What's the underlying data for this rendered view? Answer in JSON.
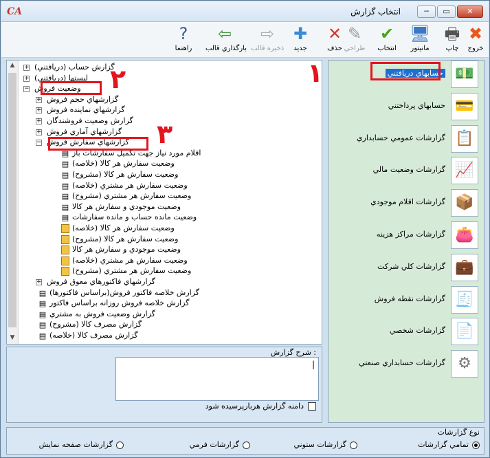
{
  "window": {
    "logo": "CA",
    "title": "انتخاب گزارش",
    "min_glyph": "─",
    "max_glyph": "▭",
    "close_glyph": "✕"
  },
  "toolbar": [
    {
      "label": "خروج",
      "icon": "close-icon",
      "glyph": "✖",
      "color": "#e8571b",
      "enabled": true
    },
    {
      "label": "چاپ",
      "icon": "printer-icon",
      "glyph": "🖶",
      "color": "#555555",
      "enabled": true
    },
    {
      "label": "مانيتور",
      "icon": "monitor-icon",
      "glyph": "🖥",
      "color": "#3b78c4",
      "enabled": true
    },
    {
      "label": "انتخاب",
      "icon": "check-icon",
      "glyph": "✔",
      "color": "#4aa31c",
      "enabled": true
    },
    {
      "label": "طراحي",
      "icon": "design-icon",
      "glyph": "✎",
      "color": "#9a9a9a",
      "enabled": false
    },
    {
      "label": "حذف",
      "icon": "delete-doc-icon",
      "glyph": "✕",
      "color": "#d23a2a",
      "enabled": true
    },
    {
      "label": "جديد",
      "icon": "new-doc-icon",
      "glyph": "✚",
      "color": "#3a8ad6",
      "enabled": true
    },
    {
      "label": "ذخيره قالب",
      "icon": "save-template-icon",
      "glyph": "⇨",
      "color": "#b0b0b0",
      "enabled": false
    },
    {
      "label": "بارگذاري قالب",
      "icon": "load-template-icon",
      "glyph": "⇦",
      "color": "#3aa038",
      "enabled": true
    },
    {
      "label": "راهنما",
      "icon": "help-icon",
      "glyph": "?",
      "color": "#3a5a8a",
      "enabled": true
    }
  ],
  "tree": [
    {
      "label": "گزارش حساب (دريافتني)",
      "level": 0,
      "expander": "+",
      "leaf": ""
    },
    {
      "label": "ليستها (دريافتني)",
      "level": 0,
      "expander": "+",
      "leaf": ""
    },
    {
      "label": "وضعيت فروش",
      "level": 0,
      "expander": "−",
      "leaf": ""
    },
    {
      "label": "گزارشهاي حجم فروش",
      "level": 1,
      "expander": "+",
      "leaf": ""
    },
    {
      "label": "گزارشهاي نماينده فروش",
      "level": 1,
      "expander": "+",
      "leaf": ""
    },
    {
      "label": "گزارش وضعيت فروشندگان",
      "level": 1,
      "expander": "+",
      "leaf": ""
    },
    {
      "label": "گزارشهاي آماري فروش",
      "level": 1,
      "expander": "+",
      "leaf": ""
    },
    {
      "label": "گزارشهاي سفارش فروش",
      "level": 1,
      "expander": "−",
      "leaf": ""
    },
    {
      "label": "اقلام مورد نياز جهت تكميل سفارشات باز",
      "level": 2,
      "expander": "",
      "leaf": "doc"
    },
    {
      "label": "وضعيت سفارش هر كالا (خلاصه)",
      "level": 2,
      "expander": "",
      "leaf": "doc"
    },
    {
      "label": "وضعيت سفارش هر كالا (مشروح)",
      "level": 2,
      "expander": "",
      "leaf": "doc"
    },
    {
      "label": "وضعيت سفارش هر مشتري (خلاصه)",
      "level": 2,
      "expander": "",
      "leaf": "doc"
    },
    {
      "label": "وضعيت سفارش هر مشتري (مشروح)",
      "level": 2,
      "expander": "",
      "leaf": "doc"
    },
    {
      "label": "وضعيت موجودي و سفارش هر كالا",
      "level": 2,
      "expander": "",
      "leaf": "doc"
    },
    {
      "label": "وضعيت مانده حساب و مانده سفارشات",
      "level": 2,
      "expander": "",
      "leaf": "doc"
    },
    {
      "label": "وضعيت سفارش هر كالا (خلاصه)",
      "level": 2,
      "expander": "",
      "leaf": "yellow"
    },
    {
      "label": "وضعيت سفارش هر كالا (مشروح)",
      "level": 2,
      "expander": "",
      "leaf": "yellow"
    },
    {
      "label": "وضعيت موجودي و سفارش هر كالا",
      "level": 2,
      "expander": "",
      "leaf": "yellow"
    },
    {
      "label": "وضعيت سفارش هر مشتري (خلاصه)",
      "level": 2,
      "expander": "",
      "leaf": "yellow"
    },
    {
      "label": "وضعيت سفارش هر مشتري (مشروح)",
      "level": 2,
      "expander": "",
      "leaf": "yellow"
    },
    {
      "label": "گزارشهاي فاكتورهاي معوق فروش",
      "level": 1,
      "expander": "+",
      "leaf": ""
    },
    {
      "label": "گزارش خلاصه فاكتور فروش(براساس فاكتورها)",
      "level": 1,
      "expander": "",
      "leaf": "doc"
    },
    {
      "label": "گزارش خلاصه فروش روزانه براساس فاكتور",
      "level": 1,
      "expander": "",
      "leaf": "doc"
    },
    {
      "label": "گزارش وضعيت فروش به مشتري",
      "level": 1,
      "expander": "",
      "leaf": "doc"
    },
    {
      "label": "گزارش مصرف كالا (مشروح)",
      "level": 1,
      "expander": "",
      "leaf": "doc"
    },
    {
      "label": "گزارش مصرف كالا (خلاصه)",
      "level": 1,
      "expander": "",
      "leaf": "doc"
    }
  ],
  "annotations": [
    "۱",
    "۲",
    "۳"
  ],
  "description": {
    "label": "شرح گزارش :",
    "value": "|",
    "checkbox_label": "دامنه گزارش هربارپرسيده شود",
    "checked": false
  },
  "categories": [
    {
      "label": "حسابهاي دريافتني",
      "icon": "money-icon",
      "glyph": "💵",
      "color": "#2f7d32",
      "selected": true
    },
    {
      "label": "حسابهاي پرداختني",
      "icon": "credit-card-icon",
      "glyph": "💳",
      "color": "#3b78c4",
      "selected": false
    },
    {
      "label": "گزارشات عمومي حسابداري",
      "icon": "clipboard-icon",
      "glyph": "📋",
      "color": "#6b6b6b",
      "selected": false
    },
    {
      "label": "گزارشات وضعيت مالي",
      "icon": "line-chart-icon",
      "glyph": "📈",
      "color": "#2f63b3",
      "selected": false
    },
    {
      "label": "گزارشات اقلام موجودي",
      "icon": "boxes-icon",
      "glyph": "📦",
      "color": "#c47a2a",
      "selected": false
    },
    {
      "label": "گزارشات مراكز هزينه",
      "icon": "wallet-icon",
      "glyph": "👛",
      "color": "#a8521a",
      "selected": false
    },
    {
      "label": "گزارشات كلي شركت",
      "icon": "briefcase-icon",
      "glyph": "💼",
      "color": "#c8661c",
      "selected": false
    },
    {
      "label": "گزارشات نقطه فروش",
      "icon": "cash-register-icon",
      "glyph": "🧾",
      "color": "#555555",
      "selected": false
    },
    {
      "label": "گزارشات شخصي",
      "icon": "document-icon",
      "glyph": "📄",
      "color": "#3b78c4",
      "selected": false
    },
    {
      "label": "گزارشات حسابداري صنعتي",
      "icon": "gear-icon",
      "glyph": "⚙",
      "color": "#777777",
      "selected": false
    }
  ],
  "report_type": {
    "label": "نوع گزارشات",
    "options": [
      {
        "label": "تمامي گزارشات",
        "selected": true
      },
      {
        "label": "گزارشات ستوني",
        "selected": false
      },
      {
        "label": "گزارشات فرمي",
        "selected": false
      },
      {
        "label": "گزارشات صفحه نمايش",
        "selected": false
      }
    ]
  }
}
